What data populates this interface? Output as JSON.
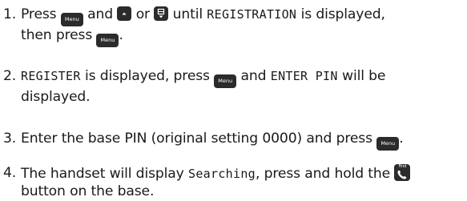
{
  "buttons": {
    "menu_label": "Menu",
    "find_label": "Find",
    "up_icon": "up-arrow-icon",
    "down_icon": "down-arrow-icon",
    "phone_icon": "phone-handset-icon"
  },
  "steps": [
    {
      "number": "1.",
      "t1": "Press",
      "t2": "and",
      "t3": "or",
      "t4": "until",
      "lcd": "REGISTRATION",
      "t5": "is displayed,",
      "t6": "then press",
      "t7": "."
    },
    {
      "number": "2.",
      "lcd1": "REGISTER",
      "t1": "is displayed, press",
      "t2": "and",
      "lcd2": "ENTER PIN",
      "t3": "will be",
      "t4": "displayed."
    },
    {
      "number": "3.",
      "t1": "Enter the base PIN (original setting 0000) and press",
      "t2": "."
    },
    {
      "number": "4.",
      "t1": "The handset will display",
      "lcd": "Searching",
      "t2": ", press and hold the",
      "t3": "button on the base."
    }
  ]
}
